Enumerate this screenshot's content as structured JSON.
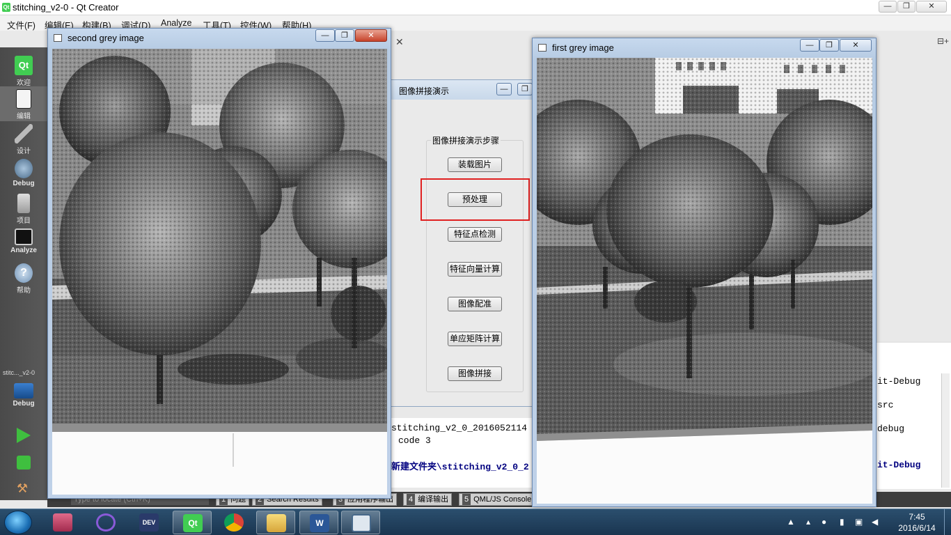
{
  "qtcreator": {
    "title": "stitching_v2-0 - Qt Creator",
    "logo": "Qt",
    "menu": [
      "文件(F)",
      "编辑(E)",
      "构建(B)",
      "调试(D)",
      "Analyze",
      "工具(T)",
      "控件(W)",
      "帮助(H)"
    ],
    "window_controls": {
      "minimize": "—",
      "maximize": "❐",
      "close": "✕"
    },
    "modes": [
      {
        "label": "欢迎",
        "icon": "qt-logo-icon"
      },
      {
        "label": "编辑",
        "icon": "edit-document-icon"
      },
      {
        "label": "设计",
        "icon": "design-pen-icon"
      },
      {
        "label": "Debug",
        "icon": "debug-bug-icon"
      },
      {
        "label": "项目",
        "icon": "project-file-icon"
      },
      {
        "label": "Analyze",
        "icon": "analyze-screen-icon"
      },
      {
        "label": "帮助",
        "icon": "help-icon"
      }
    ],
    "target": {
      "project": "stitc..._v2-0",
      "config": "Debug"
    },
    "run_controls": [
      "run-icon",
      "debug-run-icon",
      "build-hammer-icon"
    ],
    "compile_output": {
      "middle_lines": [
        "stitching_v2_0_2016052114",
        "code 3",
        "新建文件夹\\stitching_v2_0_2"
      ],
      "right_lines": [
        "it-Debug",
        "src",
        "debug",
        "it-Debug"
      ]
    },
    "output_tabs": [
      {
        "num": "1",
        "label": "问题"
      },
      {
        "num": "2",
        "label": "Search Results"
      },
      {
        "num": "3",
        "label": "应用程序输出"
      },
      {
        "num": "4",
        "label": "编译输出"
      },
      {
        "num": "5",
        "label": "QML/JS Console"
      }
    ],
    "locator_placeholder": "Type to locate (Ctrl+K)"
  },
  "dialog": {
    "title": "图像拼接演示",
    "group_title": "图像拼接演示步骤",
    "buttons": [
      "装载图片",
      "预处理",
      "特征点检测",
      "特征向量计算",
      "图像配准",
      "单应矩阵计算",
      "图像拼接"
    ],
    "highlighted": "预处理"
  },
  "window_second": {
    "title": "second grey image",
    "controls": [
      "—",
      "❐",
      "✕"
    ]
  },
  "window_first": {
    "title": "first grey image",
    "controls": [
      "—",
      "❐",
      "✕"
    ]
  },
  "taskbar": {
    "apps": [
      "start-orb-icon",
      "database-gear-icon",
      "infinity-icon",
      "devexpress-icon",
      "qt-creator-icon",
      "chrome-icon",
      "file-explorer-icon",
      "word-icon",
      "app-window-icon"
    ],
    "time": "7:45",
    "date": "2016/6/14"
  }
}
